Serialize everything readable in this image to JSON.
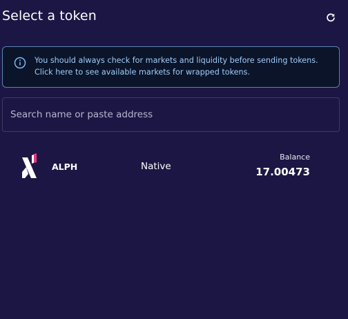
{
  "header": {
    "title": "Select a token",
    "refresh_icon": "refresh-icon"
  },
  "notice": {
    "icon": "info-icon",
    "line1": "You should always check for markets and liquidity before sending tokens.",
    "line2": "Click here to see available markets for wrapped tokens."
  },
  "search": {
    "placeholder": "Search name or paste address",
    "value": ""
  },
  "tokens": [
    {
      "symbol": "ALPH",
      "type": "Native",
      "balance_label": "Balance",
      "balance": "17.00473",
      "logo_icon": "alephium-logo-icon"
    }
  ],
  "colors": {
    "background": "#1c1644",
    "notice_bg": "#0b1428",
    "notice_border": "#5a85b0",
    "notice_text": "#9fcdfb",
    "search_border": "#3f3a63",
    "logo_accent": "#e0378a"
  }
}
